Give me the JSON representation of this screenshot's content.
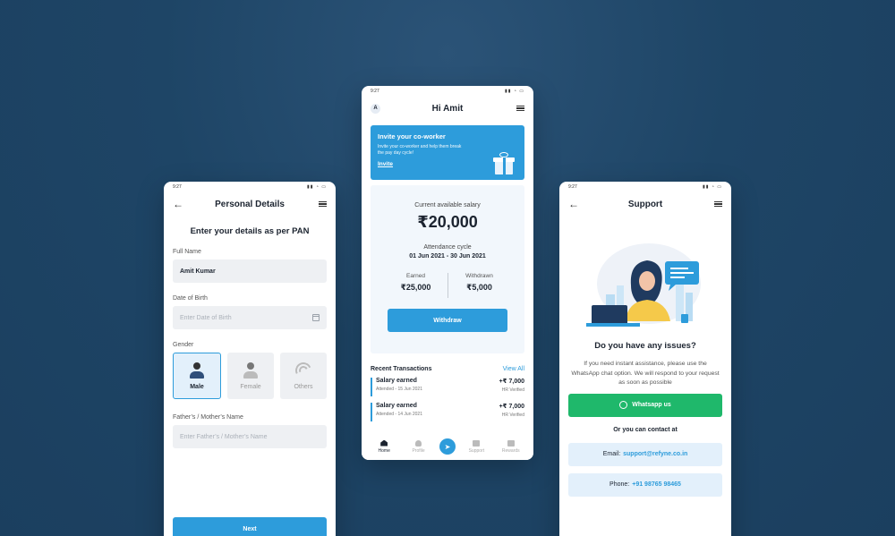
{
  "left_screen": {
    "status_time": "9:27",
    "title": "Personal Details",
    "heading": "Enter your details as per PAN",
    "full_name_label": "Full Name",
    "full_name_value": "Amit Kumar",
    "dob_label": "Date of Birth",
    "dob_placeholder": "Enter Date of Birth",
    "gender_label": "Gender",
    "gender_options": [
      "Male",
      "Female",
      "Others"
    ],
    "selected_gender": "Male",
    "parent_label": "Father’s / Mother’s Name",
    "parent_placeholder": "Enter Father’s / Mother’s Name",
    "next_label": "Next"
  },
  "center_screen": {
    "status_time": "9:27",
    "avatar_letter": "A",
    "title": "Hi Amit",
    "invite": {
      "title": "Invite your co-worker",
      "description": "Invite your co-worker and help them break the pay day cycle!",
      "link": "Invite"
    },
    "salary_label": "Current available salary",
    "salary_value": "₹20,000",
    "cycle_label": "Attendance cycle",
    "cycle_value": "01 Jun 2021 - 30 Jun 2021",
    "earned_label": "Earned",
    "earned_value": "₹25,000",
    "withdrawn_label": "Withdrawn",
    "withdrawn_value": "₹5,000",
    "withdraw_button": "Withdraw",
    "recent_title": "Recent Transactions",
    "view_all": "View All",
    "transactions": [
      {
        "name": "Salary earned",
        "date": "Attended - 15 Jun 2021",
        "amount": "+₹ 7,000",
        "status": "HR Verified"
      },
      {
        "name": "Salary earned",
        "date": "Attended - 14 Jun 2021",
        "amount": "+₹ 7,000",
        "status": "HR Verified"
      }
    ],
    "nav": [
      "Home",
      "Profile",
      "Support",
      "Rewards"
    ]
  },
  "right_screen": {
    "status_time": "9:27",
    "title": "Support",
    "question": "Do you have any issues?",
    "description": "If you need instant assistance, please use the WhatsApp chat option. We will respond to your request as soon as possible",
    "whatsapp_button": "Whatsapp us",
    "or_contact": "Or you can contact at",
    "email_label": "Email:",
    "email_value": "support@refyne.co.in",
    "phone_label": "Phone:",
    "phone_value": "+91 98765 98465"
  },
  "colors": {
    "accent": "#2d9cdb",
    "whatsapp": "#1fb86b",
    "background": "#1e4566"
  }
}
